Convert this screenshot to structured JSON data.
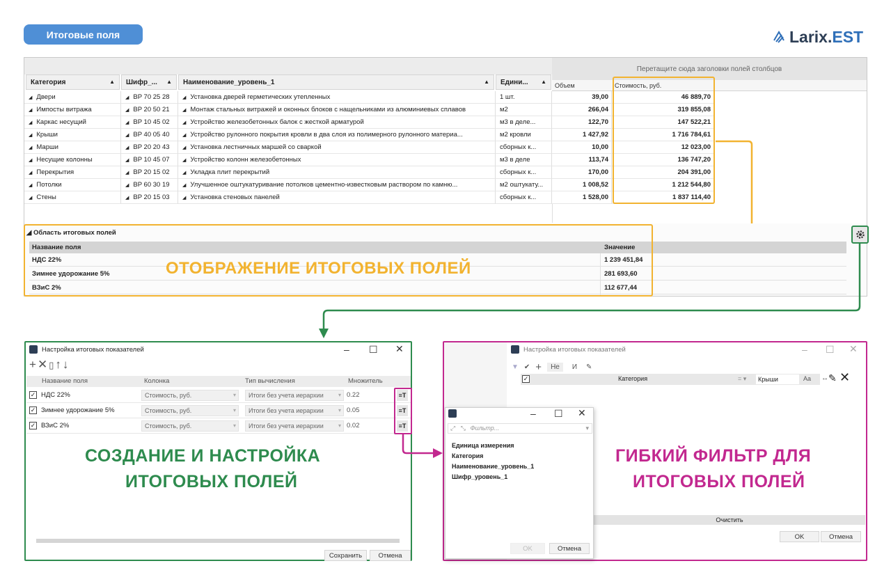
{
  "header": {
    "pill_label": "Итоговые поля",
    "logo_text": "Larix.",
    "logo_accent": "EST"
  },
  "grid": {
    "group_hint": "Перетащите сюда заголовки полей столбцов",
    "columns": [
      "Категория",
      "Шифр_...",
      "Наименование_уровень_1",
      "Едини...",
      "Объем",
      "Стоимость, руб."
    ],
    "rows": [
      {
        "cat": "Двери",
        "code": "BP 70 25 28",
        "name": "Установка дверей герметических утепленных",
        "unit": "1 шт.",
        "vol": "39,00",
        "cost": "46 889,70"
      },
      {
        "cat": "Импосты витража",
        "code": "BP 20 50 21",
        "name": "Монтаж стальных витражей и оконных блоков с нащельниками из алюминиевых сплавов",
        "unit": "м2",
        "vol": "266,04",
        "cost": "319 855,08"
      },
      {
        "cat": "Каркас несущий",
        "code": "BP 10 45 02",
        "name": "Устройство железобетонных балок с жесткой арматурой",
        "unit": "м3 в деле...",
        "vol": "122,70",
        "cost": "147 522,21"
      },
      {
        "cat": "Крыши",
        "code": "BP 40 05 40",
        "name": "Устройство рулонного покрытия кровли в два слоя из полимерного рулонного материа...",
        "unit": "м2 кровли",
        "vol": "1 427,92",
        "cost": "1 716 784,61"
      },
      {
        "cat": "Марши",
        "code": "BP 20 20 43",
        "name": "Установка лестничных маршей со сваркой",
        "unit": "сборных к...",
        "vol": "10,00",
        "cost": "12 023,00"
      },
      {
        "cat": "Несущие колонны",
        "code": "BP 10 45 07",
        "name": "Устройство колонн железобетонных",
        "unit": "м3 в деле",
        "vol": "113,74",
        "cost": "136 747,20"
      },
      {
        "cat": "Перекрытия",
        "code": "BP 20 15 02",
        "name": "Укладка плит перекрытий",
        "unit": "сборных к...",
        "vol": "170,00",
        "cost": "204 391,00"
      },
      {
        "cat": "Потолки",
        "code": "BP 60 30 19",
        "name": "Улучшенное оштукатуривание потолков цементно-известковым раствором по камню...",
        "unit": "м2 оштукату...",
        "vol": "1 008,52",
        "cost": "1 212 544,80"
      },
      {
        "cat": "Стены",
        "code": "BP 20 15 03",
        "name": "Установка стеновых панелей",
        "unit": "сборных к...",
        "vol": "1 528,00",
        "cost": "1 837 114,40"
      }
    ]
  },
  "summary": {
    "title": "Область итоговых полей",
    "col_name": "Название поля",
    "col_value": "Значение",
    "rows": [
      {
        "name": "НДС 22%",
        "value": "1 239 451,84"
      },
      {
        "name": "Зимнее удорожание 5%",
        "value": "281 693,60"
      },
      {
        "name": "ВЗиС 2%",
        "value": "112 677,44"
      }
    ],
    "caption": "ОТОБРАЖЕНИЕ ИТОГОВЫХ ПОЛЕЙ"
  },
  "dialog1": {
    "title": "Настройка итоговых показателей",
    "columns": [
      "Название поля",
      "Колонка",
      "Тип вычисления",
      "Множитель"
    ],
    "rows": [
      {
        "checked": "✓",
        "name": "НДС 22%",
        "column": "Стоимость, руб.",
        "calc": "Итоги без учета иерархии",
        "mult": "0.22"
      },
      {
        "checked": "✓",
        "name": "Зимнее удорожание 5%",
        "column": "Стоимость, руб.",
        "calc": "Итоги без учета иерархии",
        "mult": "0.05"
      },
      {
        "checked": "✓",
        "name": "ВЗиС 2%",
        "column": "Стоимость, руб.",
        "calc": "Итоги без учета иерархии",
        "mult": "0.02"
      }
    ],
    "caption_line1": "СОЗДАНИЕ И НАСТРОЙКА",
    "caption_line2": "ИТОГОВЫХ ПОЛЕЙ",
    "save_label": "Сохранить",
    "cancel_label": "Отмена"
  },
  "dialog2": {
    "title": "Настройка итоговых показателей",
    "not_label": "Не",
    "and_label": "И",
    "field": "Категория",
    "op": "=",
    "value": "Крыши",
    "aa_label": "Aa",
    "clear_label": "Очистить",
    "ok_label": "OK",
    "cancel_label": "Отмена",
    "caption_line1": "ГИБКИЙ ФИЛЬТР ДЛЯ",
    "caption_line2": "ИТОГОВЫХ ПОЛЕЙ"
  },
  "popup": {
    "filter_placeholder": "Фильтр...",
    "items": [
      "Единица измерения",
      "Категория",
      "Наименование_уровень_1",
      "Шифр_уровень_1"
    ],
    "ok_label": "OK",
    "cancel_label": "Отмена"
  },
  "colors": {
    "accent_blue": "#4f8fd6",
    "orange": "#f2b330",
    "green": "#2e8b4e",
    "pink": "#c2288f"
  }
}
